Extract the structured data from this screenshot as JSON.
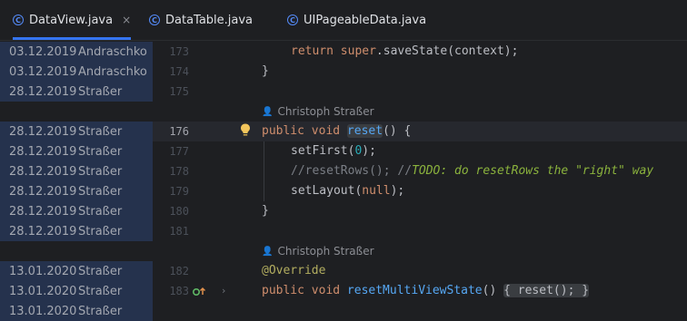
{
  "tabs": [
    {
      "label": "DataView.java",
      "icon": "class-c-icon",
      "active": true,
      "close": "×"
    },
    {
      "label": "DataTable.java",
      "icon": "class-c-icon",
      "active": false
    },
    {
      "label": "UIPageableData.java",
      "icon": "class-c-icon",
      "active": false
    }
  ],
  "blame": [
    {
      "date": "03.12.2019",
      "author": "Andraschko"
    },
    {
      "date": "03.12.2019",
      "author": "Andraschko"
    },
    {
      "date": "28.12.2019",
      "author": "Straßer"
    },
    {
      "date": "28.12.2019",
      "author": "Straßer"
    },
    {
      "date": "28.12.2019",
      "author": "Straßer"
    },
    {
      "date": "28.12.2019",
      "author": "Straßer"
    },
    {
      "date": "28.12.2019",
      "author": "Straßer"
    },
    {
      "date": "28.12.2019",
      "author": "Straßer"
    },
    {
      "date": "28.12.2019",
      "author": "Straßer"
    },
    {
      "date": "13.01.2020",
      "author": "Straßer"
    },
    {
      "date": "13.01.2020",
      "author": "Straßer"
    },
    {
      "date": "13.01.2020",
      "author": "Straßer"
    }
  ],
  "line_numbers": [
    "173",
    "174",
    "175",
    "176",
    "177",
    "178",
    "179",
    "180",
    "181",
    "182",
    "183"
  ],
  "inlay_author_1": "Christoph Straßer",
  "inlay_author_2": "Christoph Straßer",
  "code": {
    "l173": {
      "kw": "return super",
      "rest": ".saveState(context);"
    },
    "l174": "}",
    "l176_kw": "public void ",
    "l176_fn": "reset",
    "l176_rest": "() {",
    "l177_a": "setFirst(",
    "l177_num": "0",
    "l177_b": ");",
    "l178_cm": "//resetRows(); //",
    "l178_todo": "TODO: do resetRows the \"right\" way",
    "l179_a": "setLayout(",
    "l179_kw": "null",
    "l179_b": ");",
    "l180": "}",
    "l182_ann": "@Override",
    "l183_kw": "public void ",
    "l183_fn": "resetMultiViewState",
    "l183_a": "()",
    "l183_b": "{ reset(); }"
  },
  "colors": {
    "accent": "#3574f0",
    "blame_bg": "#25324d",
    "keyword": "#cf8e6d",
    "function": "#56a8f5"
  }
}
